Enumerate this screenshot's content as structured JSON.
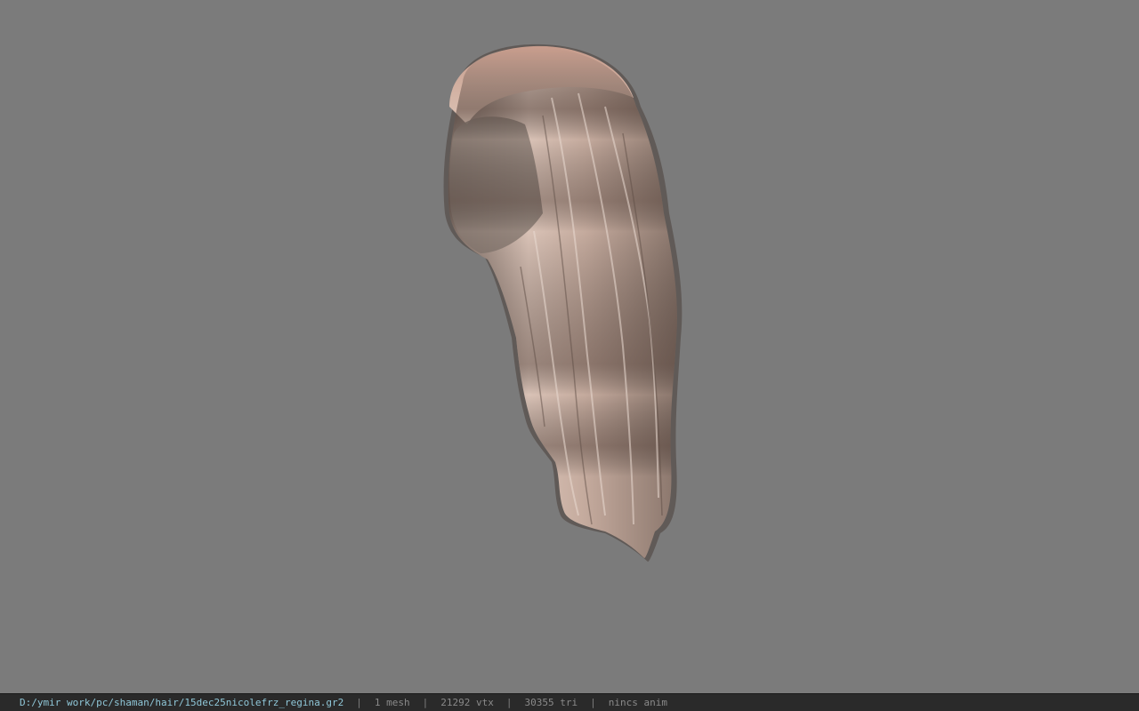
{
  "viewport": {
    "background_color": "#7b7b7b",
    "model_icon": "hair-mesh-icon"
  },
  "status_bar": {
    "file_path": "D:/ymir work/pc/shaman/hair/15dec25nicolefrz_regina.gr2",
    "separator": "|",
    "mesh_count": "1 mesh",
    "vertex_count": "21292 vtx",
    "triangle_count": "30355 tri",
    "anim_status": "nincs anim",
    "path_color": "#8fc7d8",
    "text_color": "#8a8a8a"
  }
}
